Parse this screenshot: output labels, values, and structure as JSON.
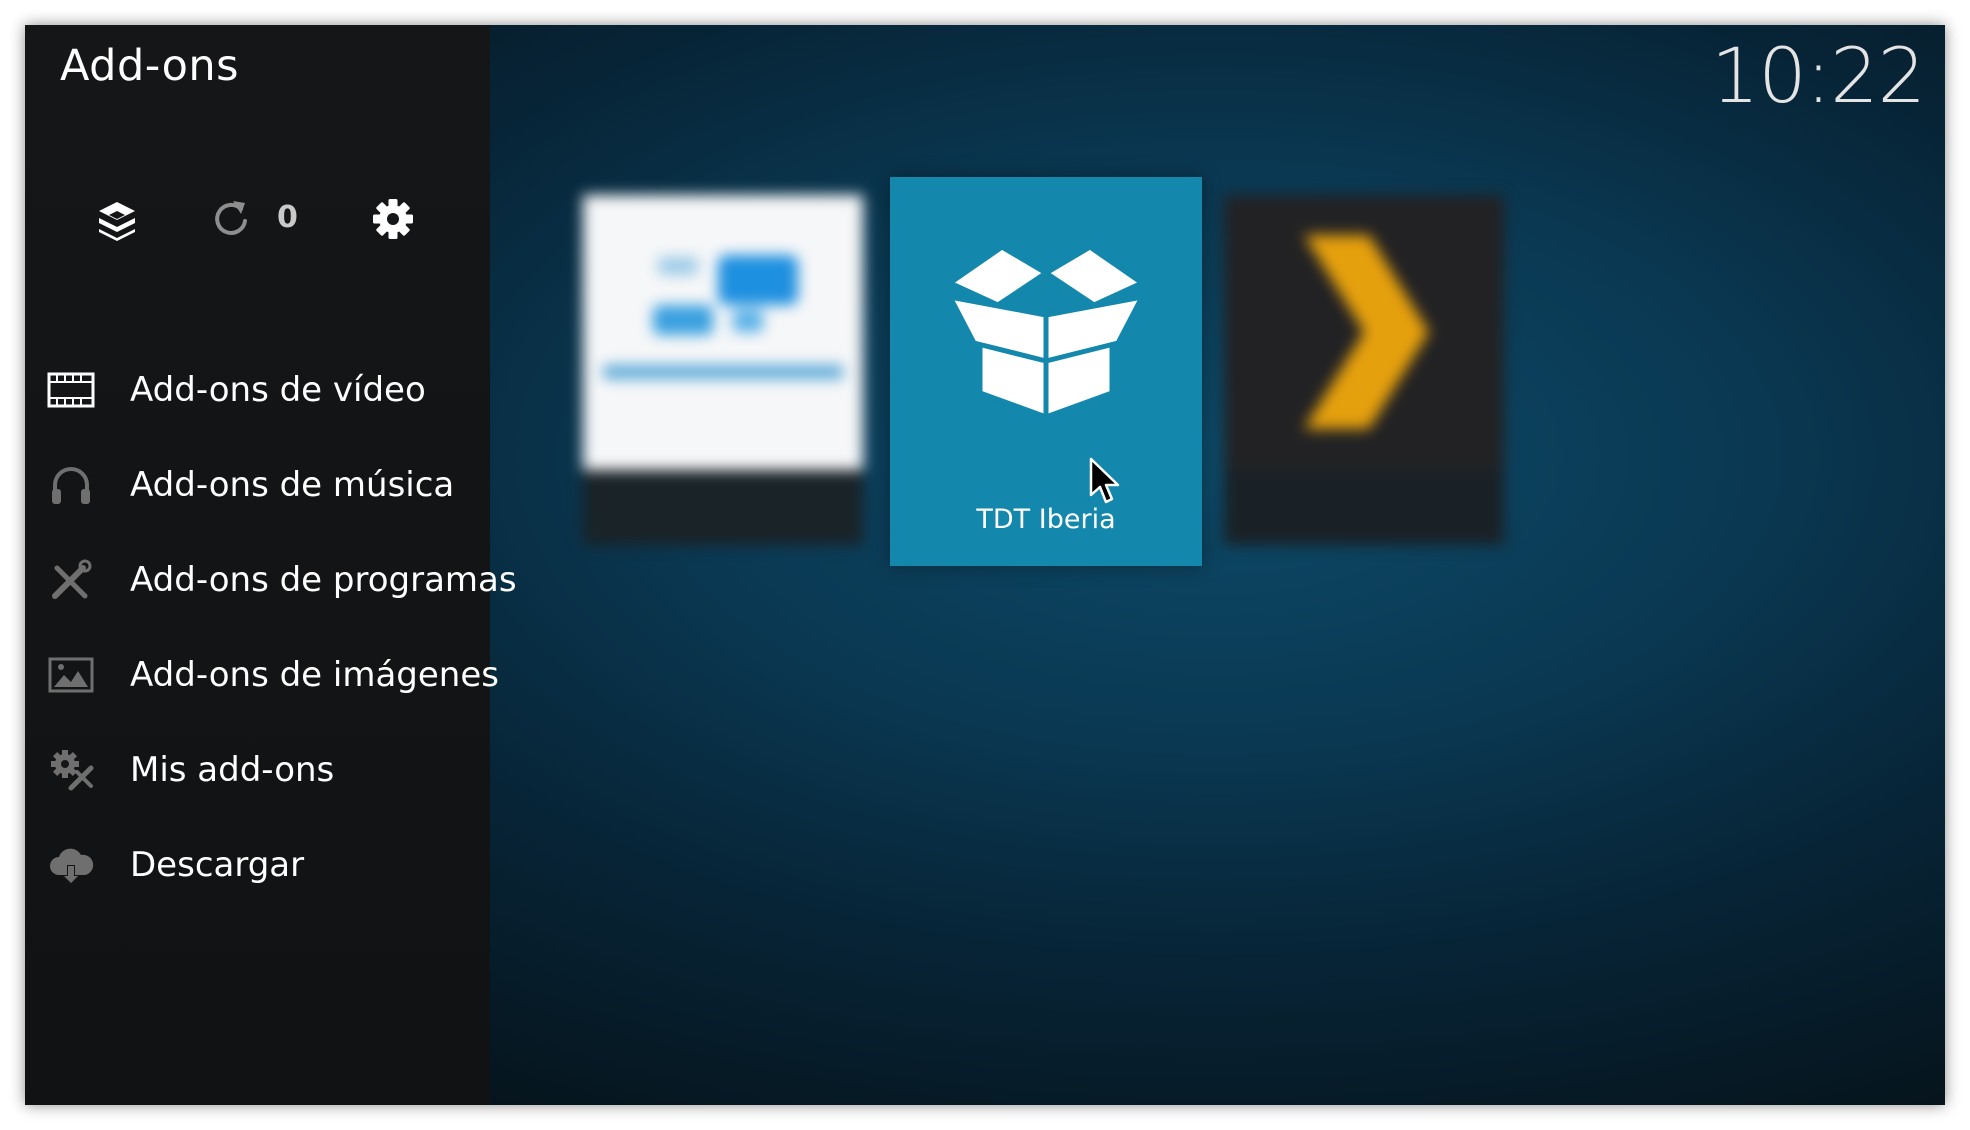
{
  "window": {
    "title": "Add-ons",
    "clock": "10:22"
  },
  "toolbar": {
    "update_count": "0"
  },
  "sidebar": {
    "items": [
      {
        "label": "Add-ons de vídeo",
        "icon": "film-icon"
      },
      {
        "label": "Add-ons de música",
        "icon": "headphones-icon"
      },
      {
        "label": "Add-ons de programas",
        "icon": "tools-icon"
      },
      {
        "label": "Add-ons de imágenes",
        "icon": "image-icon"
      },
      {
        "label": "Mis add-ons",
        "icon": "gears-icon"
      },
      {
        "label": "Descargar",
        "icon": "cloud-download-icon"
      }
    ]
  },
  "addons": {
    "selected": {
      "label": "TDT Iberia",
      "icon": "open-box-icon"
    }
  },
  "colors": {
    "background": "#0a3852",
    "sidebar": "#141618",
    "selected_tile": "#1387ac",
    "plex_accent": "#e5a00d"
  }
}
